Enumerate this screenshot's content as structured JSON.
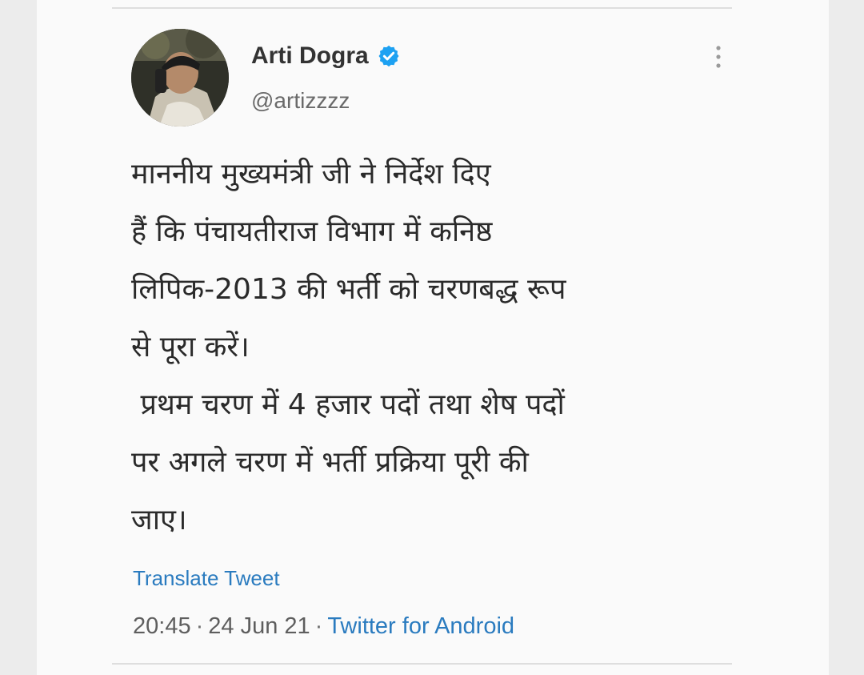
{
  "user": {
    "display_name": "Arti Dogra",
    "handle": "@artizzzz",
    "verified": true
  },
  "tweet": {
    "lines": [
      "माननीय मुख्यमंत्री जी ने निर्देश दिए",
      "हैं कि पंचायतीराज विभाग में कनिष्ठ",
      "लिपिक-2013 की भर्ती को चरणबद्ध रूप",
      "से पूरा करें।",
      " प्रथम चरण में 4 हजार पदों तथा शेष पदों",
      "पर अगले चरण में भर्ती प्रक्रिया पूरी की",
      "जाए।"
    ]
  },
  "translate_label": "Translate Tweet",
  "meta": {
    "time": "20:45",
    "date": "24 Jun 21",
    "separator": "·",
    "source": "Twitter for Android"
  },
  "colors": {
    "link": "#2a7bbf",
    "verified_badge": "#1da1f2",
    "text": "#2a2a2a",
    "muted": "#6a6a6a"
  },
  "icons": {
    "verified": "verified-badge-icon",
    "more": "more-vertical-icon"
  }
}
